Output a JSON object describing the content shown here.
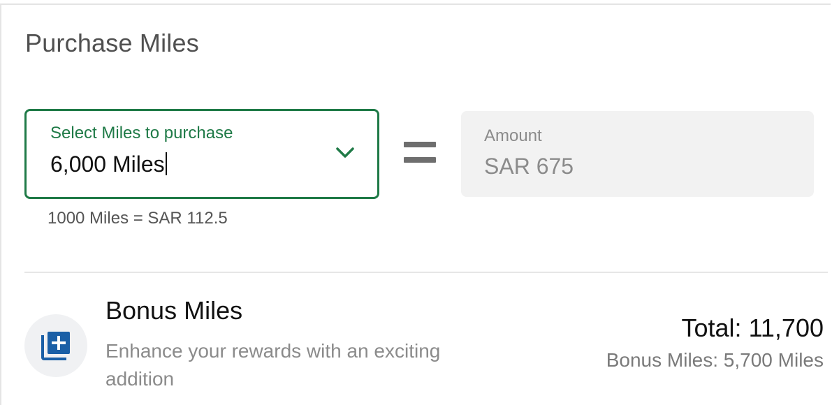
{
  "page_title": "Purchase Miles",
  "miles_select": {
    "label": "Select Miles to purchase",
    "value": "6,000 Miles",
    "accent_color": "#1f7a47",
    "icon": "chevron-down-icon"
  },
  "equals_icon": "equals-icon",
  "amount": {
    "label": "Amount",
    "value": "SAR 675"
  },
  "rate_text": "1000 Miles = SAR 112.5",
  "bonus": {
    "icon": "add-to-collection-icon",
    "icon_color": "#1a5fa6",
    "title": "Bonus Miles",
    "description": "Enhance your rewards with an exciting addition",
    "total": "Total: 11,700",
    "bonus_miles": "Bonus Miles: 5,700 Miles"
  }
}
